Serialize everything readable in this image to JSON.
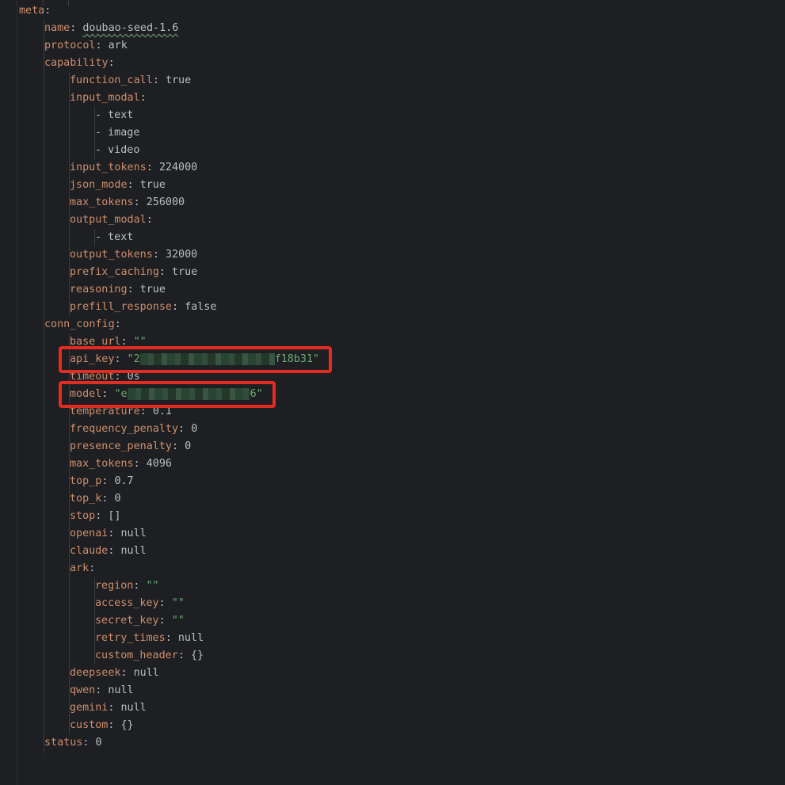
{
  "lines": [
    {
      "indent": 0,
      "key": "meta",
      "sep": ":",
      "value": "",
      "type": "plain"
    },
    {
      "indent": 1,
      "key": "name",
      "sep": ": ",
      "value": "doubao-seed-1.6",
      "type": "squiggle"
    },
    {
      "indent": 1,
      "key": "protocol",
      "sep": ": ",
      "value": "ark",
      "type": "plain"
    },
    {
      "indent": 1,
      "key": "capability",
      "sep": ":",
      "value": "",
      "type": "plain"
    },
    {
      "indent": 2,
      "key": "function_call",
      "sep": ": ",
      "value": "true",
      "type": "plain"
    },
    {
      "indent": 2,
      "key": "input_modal",
      "sep": ":",
      "value": "",
      "type": "plain"
    },
    {
      "indent": 3,
      "key": "",
      "sep": "",
      "value": "- text",
      "type": "list"
    },
    {
      "indent": 3,
      "key": "",
      "sep": "",
      "value": "- image",
      "type": "list"
    },
    {
      "indent": 3,
      "key": "",
      "sep": "",
      "value": "- video",
      "type": "list"
    },
    {
      "indent": 2,
      "key": "input_tokens",
      "sep": ": ",
      "value": "224000",
      "type": "plain"
    },
    {
      "indent": 2,
      "key": "json_mode",
      "sep": ": ",
      "value": "true",
      "type": "plain"
    },
    {
      "indent": 2,
      "key": "max_tokens",
      "sep": ": ",
      "value": "256000",
      "type": "plain"
    },
    {
      "indent": 2,
      "key": "output_modal",
      "sep": ":",
      "value": "",
      "type": "plain"
    },
    {
      "indent": 3,
      "key": "",
      "sep": "",
      "value": "- text",
      "type": "list"
    },
    {
      "indent": 2,
      "key": "output_tokens",
      "sep": ": ",
      "value": "32000",
      "type": "plain"
    },
    {
      "indent": 2,
      "key": "prefix_caching",
      "sep": ": ",
      "value": "true",
      "type": "plain"
    },
    {
      "indent": 2,
      "key": "reasoning",
      "sep": ": ",
      "value": "true",
      "type": "plain"
    },
    {
      "indent": 2,
      "key": "prefill_response",
      "sep": ": ",
      "value": "false",
      "type": "plain"
    },
    {
      "indent": 1,
      "key": "conn_config",
      "sep": ":",
      "value": "",
      "type": "plain"
    },
    {
      "indent": 2,
      "key": "base_url",
      "sep": ": ",
      "value": "\"\"",
      "type": "string"
    },
    {
      "indent": 2,
      "key": "api_key",
      "sep": ": ",
      "value_start": "\"2",
      "value_end": "f18b31\"",
      "type": "redacted",
      "redact_width": 170
    },
    {
      "indent": 2,
      "key": "timeout",
      "sep": ": ",
      "value": "0s",
      "type": "plain"
    },
    {
      "indent": 2,
      "key": "model",
      "sep": ": ",
      "value_start": "\"e",
      "value_end": "6\"",
      "type": "redacted",
      "redact_width": 155
    },
    {
      "indent": 2,
      "key": "temperature",
      "sep": ": ",
      "value": "0.1",
      "type": "plain"
    },
    {
      "indent": 2,
      "key": "frequency_penalty",
      "sep": ": ",
      "value": "0",
      "type": "plain"
    },
    {
      "indent": 2,
      "key": "presence_penalty",
      "sep": ": ",
      "value": "0",
      "type": "plain"
    },
    {
      "indent": 2,
      "key": "max_tokens",
      "sep": ": ",
      "value": "4096",
      "type": "plain"
    },
    {
      "indent": 2,
      "key": "top_p",
      "sep": ": ",
      "value": "0.7",
      "type": "plain"
    },
    {
      "indent": 2,
      "key": "top_k",
      "sep": ": ",
      "value": "0",
      "type": "plain"
    },
    {
      "indent": 2,
      "key": "stop",
      "sep": ": ",
      "value": "[]",
      "type": "plain"
    },
    {
      "indent": 2,
      "key": "openai",
      "sep": ": ",
      "value": "null",
      "type": "plain"
    },
    {
      "indent": 2,
      "key": "claude",
      "sep": ": ",
      "value": "null",
      "type": "plain"
    },
    {
      "indent": 2,
      "key": "ark",
      "sep": ":",
      "value": "",
      "type": "plain"
    },
    {
      "indent": 3,
      "key": "region",
      "sep": ": ",
      "value": "\"\"",
      "type": "string"
    },
    {
      "indent": 3,
      "key": "access_key",
      "sep": ": ",
      "value": "\"\"",
      "type": "string"
    },
    {
      "indent": 3,
      "key": "secret_key",
      "sep": ": ",
      "value": "\"\"",
      "type": "string"
    },
    {
      "indent": 3,
      "key": "retry_times",
      "sep": ": ",
      "value": "null",
      "type": "plain"
    },
    {
      "indent": 3,
      "key": "custom_header",
      "sep": ": ",
      "value": "{}",
      "type": "plain"
    },
    {
      "indent": 2,
      "key": "deepseek",
      "sep": ": ",
      "value": "null",
      "type": "plain"
    },
    {
      "indent": 2,
      "key": "qwen",
      "sep": ": ",
      "value": "null",
      "type": "plain"
    },
    {
      "indent": 2,
      "key": "gemini",
      "sep": ": ",
      "value": "null",
      "type": "plain"
    },
    {
      "indent": 2,
      "key": "custom",
      "sep": ": ",
      "value": "{}",
      "type": "plain"
    },
    {
      "indent": 1,
      "key": "status",
      "sep": ": ",
      "value": "0",
      "type": "plain"
    }
  ],
  "highlighted_keys": [
    "api_key",
    "model"
  ],
  "colors": {
    "background": "#1e1f22",
    "key": "#cf8e6d",
    "text": "#bcbec4",
    "string": "#6aab73",
    "highlight_box": "#e32b22"
  }
}
